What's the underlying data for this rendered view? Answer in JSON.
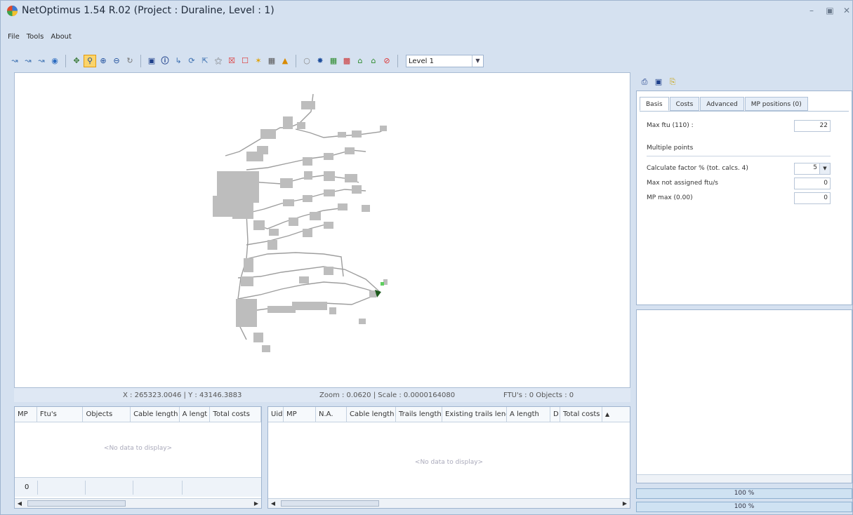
{
  "window": {
    "title": "NetOptimus 1.54 R.02 (Project : Duraline, Level : 1)",
    "controls": [
      "minimize",
      "maximize",
      "close"
    ]
  },
  "menu": [
    "File",
    "Tools",
    "About"
  ],
  "toolbar": {
    "level_value": "Level 1",
    "icons": [
      "select-icon",
      "select-add-icon",
      "select-remove-icon",
      "globe-icon",
      "pan-icon",
      "zoom-window-icon",
      "zoom-in-icon",
      "zoom-out-icon",
      "refresh-icon",
      "save-icon",
      "info-icon",
      "path-icon",
      "cycle-icon",
      "zoom-extent-icon",
      "network-icon",
      "delete-box-icon",
      "frame-icon",
      "star-icon",
      "buildings-icon",
      "chart-icon",
      "circle-icon",
      "point-icon",
      "table-icon",
      "grid-icon",
      "home-green-icon",
      "home-icon",
      "forbidden-icon"
    ]
  },
  "status": {
    "coords": "X : 265323.0046 | Y : 43146.3883",
    "zoom": "Zoom : 0.0620 | Scale : 0.0000164080",
    "counts": "FTU's : 0 Objects : 0"
  },
  "left_grid": {
    "columns": [
      "MP",
      "Ftu's",
      "Objects",
      "Cable length",
      "A lengt",
      "Total costs"
    ],
    "empty_text": "<No data to display>",
    "footer_value": "0"
  },
  "right_grid": {
    "columns": [
      "Uid",
      "MP",
      "N.A.",
      "Cable length",
      "Trails length",
      "Existing trails leng",
      "A length",
      "D",
      "Total costs"
    ],
    "empty_text": "<No data to display>"
  },
  "properties": {
    "tabs": [
      "Basis",
      "Costs",
      "Advanced",
      "MP positions (0)"
    ],
    "max_ftu_label": "Max ftu (110) :",
    "max_ftu_value": "22",
    "section_label": "Multiple points",
    "calc_factor_label": "Calculate factor % (tot. calcs. 4)",
    "calc_factor_value": "5",
    "max_not_assigned_label": "Max not assigned ftu/s",
    "max_not_assigned_value": "0",
    "mp_max_label": "MP max (0.00)",
    "mp_max_value": "0"
  },
  "progress": [
    {
      "label": "100 %",
      "value": 1.0
    },
    {
      "label": "100 %",
      "value": 1.0
    }
  ]
}
